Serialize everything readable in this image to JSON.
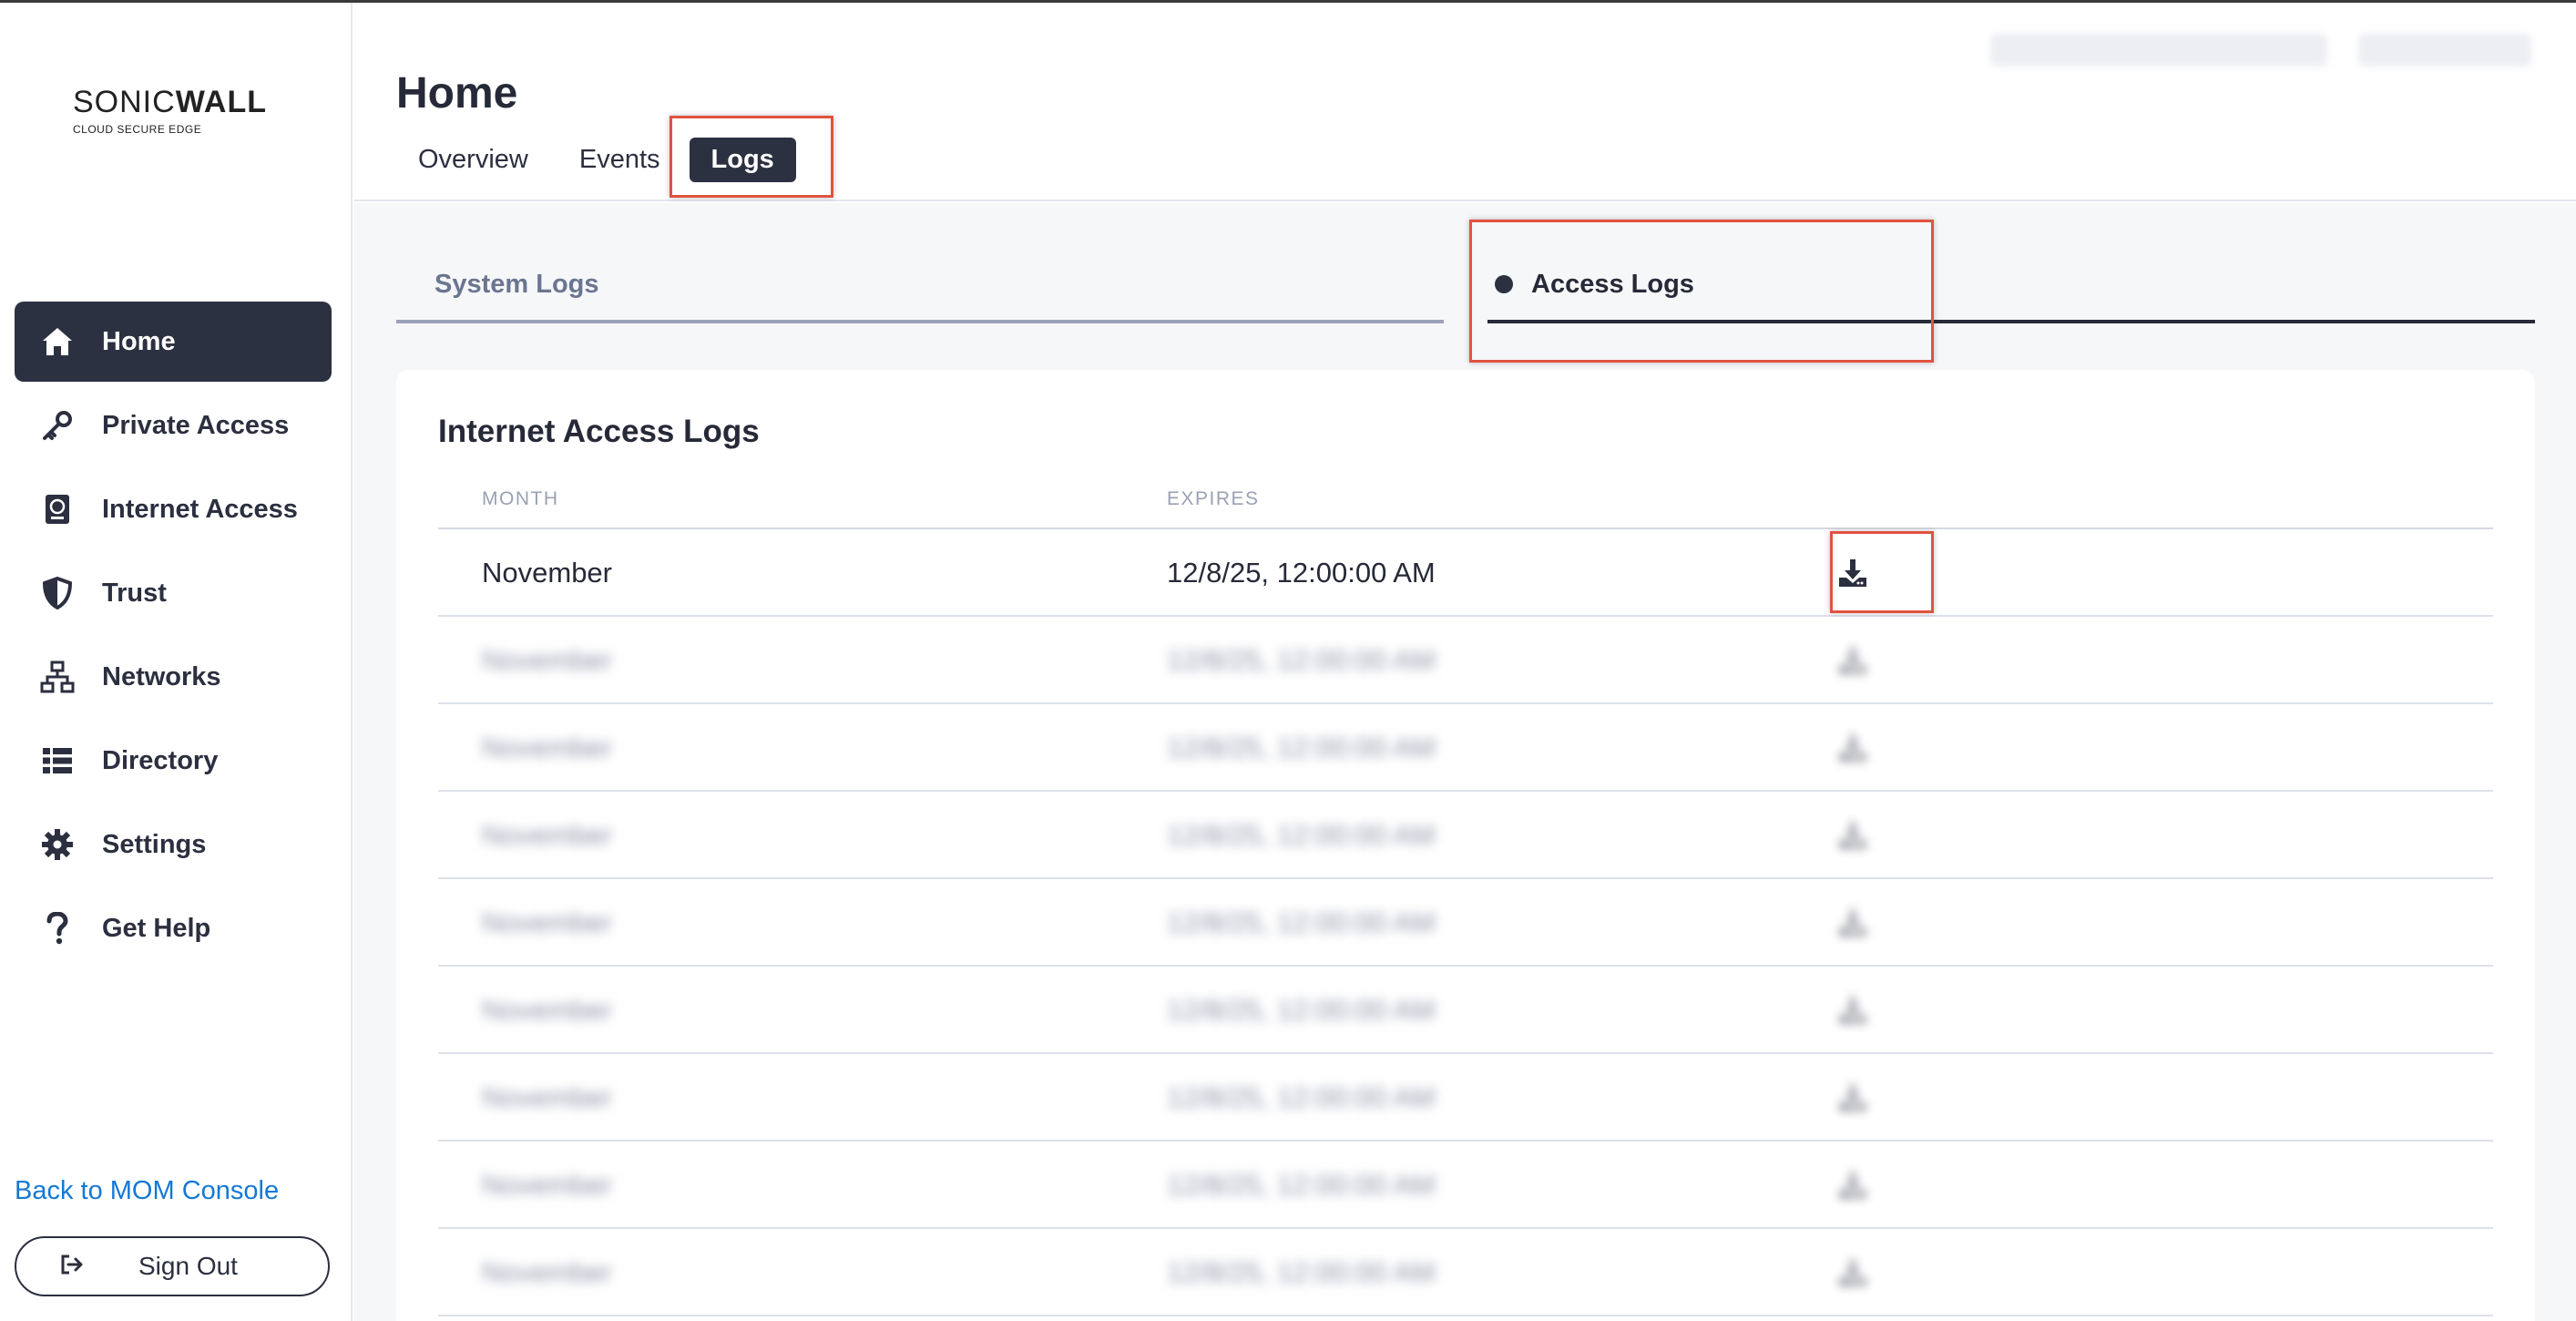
{
  "brand": {
    "logo_main_a": "SONIC",
    "logo_main_b": "WALL",
    "logo_sub": "CLOUD SECURE EDGE"
  },
  "sidebar": {
    "items": [
      {
        "label": "Home",
        "icon": "home-icon",
        "active": true
      },
      {
        "label": "Private Access",
        "icon": "key-icon",
        "active": false
      },
      {
        "label": "Internet Access",
        "icon": "passport-icon",
        "active": false
      },
      {
        "label": "Trust",
        "icon": "shield-icon",
        "active": false
      },
      {
        "label": "Networks",
        "icon": "network-icon",
        "active": false
      },
      {
        "label": "Directory",
        "icon": "list-icon",
        "active": false
      },
      {
        "label": "Settings",
        "icon": "gear-icon",
        "active": false
      },
      {
        "label": "Get Help",
        "icon": "question-icon",
        "active": false
      }
    ],
    "back_link": "Back to MOM Console",
    "sign_out": "Sign Out"
  },
  "header": {
    "title": "Home",
    "tabs": [
      {
        "label": "Overview",
        "active": false
      },
      {
        "label": "Events",
        "active": false
      },
      {
        "label": "Logs",
        "active": true
      }
    ]
  },
  "log_tabs": {
    "system": "System Logs",
    "access": "Access Logs",
    "active": "access"
  },
  "card": {
    "title": "Internet Access Logs",
    "columns": {
      "month": "MONTH",
      "expires": "EXPIRES"
    },
    "rows": [
      {
        "month": "November",
        "expires": "12/8/25, 12:00:00 AM",
        "blurred": false
      },
      {
        "month": "November",
        "expires": "12/8/25, 12:00:00 AM",
        "blurred": true
      },
      {
        "month": "November",
        "expires": "12/8/25, 12:00:00 AM",
        "blurred": true
      },
      {
        "month": "November",
        "expires": "12/8/25, 12:00:00 AM",
        "blurred": true
      },
      {
        "month": "November",
        "expires": "12/8/25, 12:00:00 AM",
        "blurred": true
      },
      {
        "month": "November",
        "expires": "12/8/25, 12:00:00 AM",
        "blurred": true
      },
      {
        "month": "November",
        "expires": "12/8/25, 12:00:00 AM",
        "blurred": true
      },
      {
        "month": "November",
        "expires": "12/8/25, 12:00:00 AM",
        "blurred": true
      },
      {
        "month": "November",
        "expires": "12/8/25, 12:00:00 AM",
        "blurred": true
      }
    ]
  },
  "colors": {
    "accent_dark": "#2c3142",
    "link": "#1479d4",
    "highlight": "#e0533f"
  }
}
